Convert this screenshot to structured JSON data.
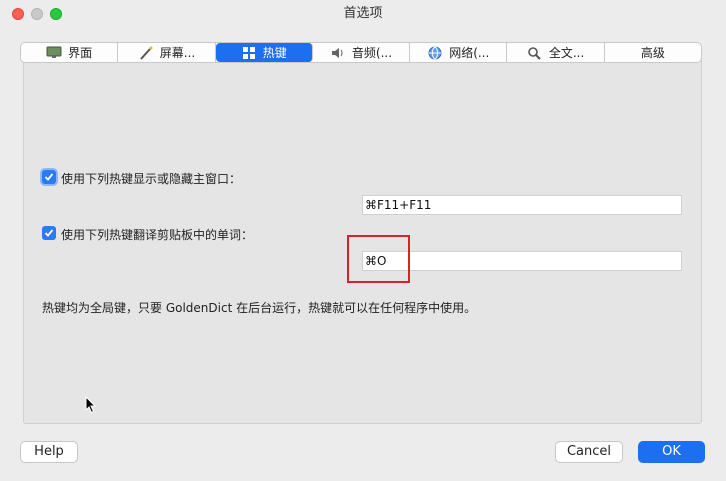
{
  "window": {
    "title": "首选项"
  },
  "tabs": [
    {
      "label": "界面",
      "icon": "monitor-icon"
    },
    {
      "label": "屏幕...",
      "icon": "magic-wand-icon"
    },
    {
      "label": "热键",
      "icon": "keyboard-icon",
      "active": true
    },
    {
      "label": "音频(...",
      "icon": "speaker-icon"
    },
    {
      "label": "网络(...",
      "icon": "globe-icon"
    },
    {
      "label": "全文...",
      "icon": "magnifier-icon"
    },
    {
      "label": "高级",
      "icon": ""
    }
  ],
  "hotkeys": {
    "toggle_window": {
      "label": "使用下列热键显示或隐藏主窗口：",
      "checked": true,
      "value": "⌘F11+F11"
    },
    "translate_clipboard": {
      "label": "使用下列热键翻译剪贴板中的单词：",
      "checked": true,
      "value": "⌘O"
    },
    "note": "热键均为全局键，只要 GoldenDict 在后台运行，热键就可以在任何程序中使用。"
  },
  "buttons": {
    "help": "Help",
    "cancel": "Cancel",
    "ok": "OK"
  },
  "colors": {
    "accent": "#1d6ff2",
    "highlight_box": "#d42428"
  }
}
